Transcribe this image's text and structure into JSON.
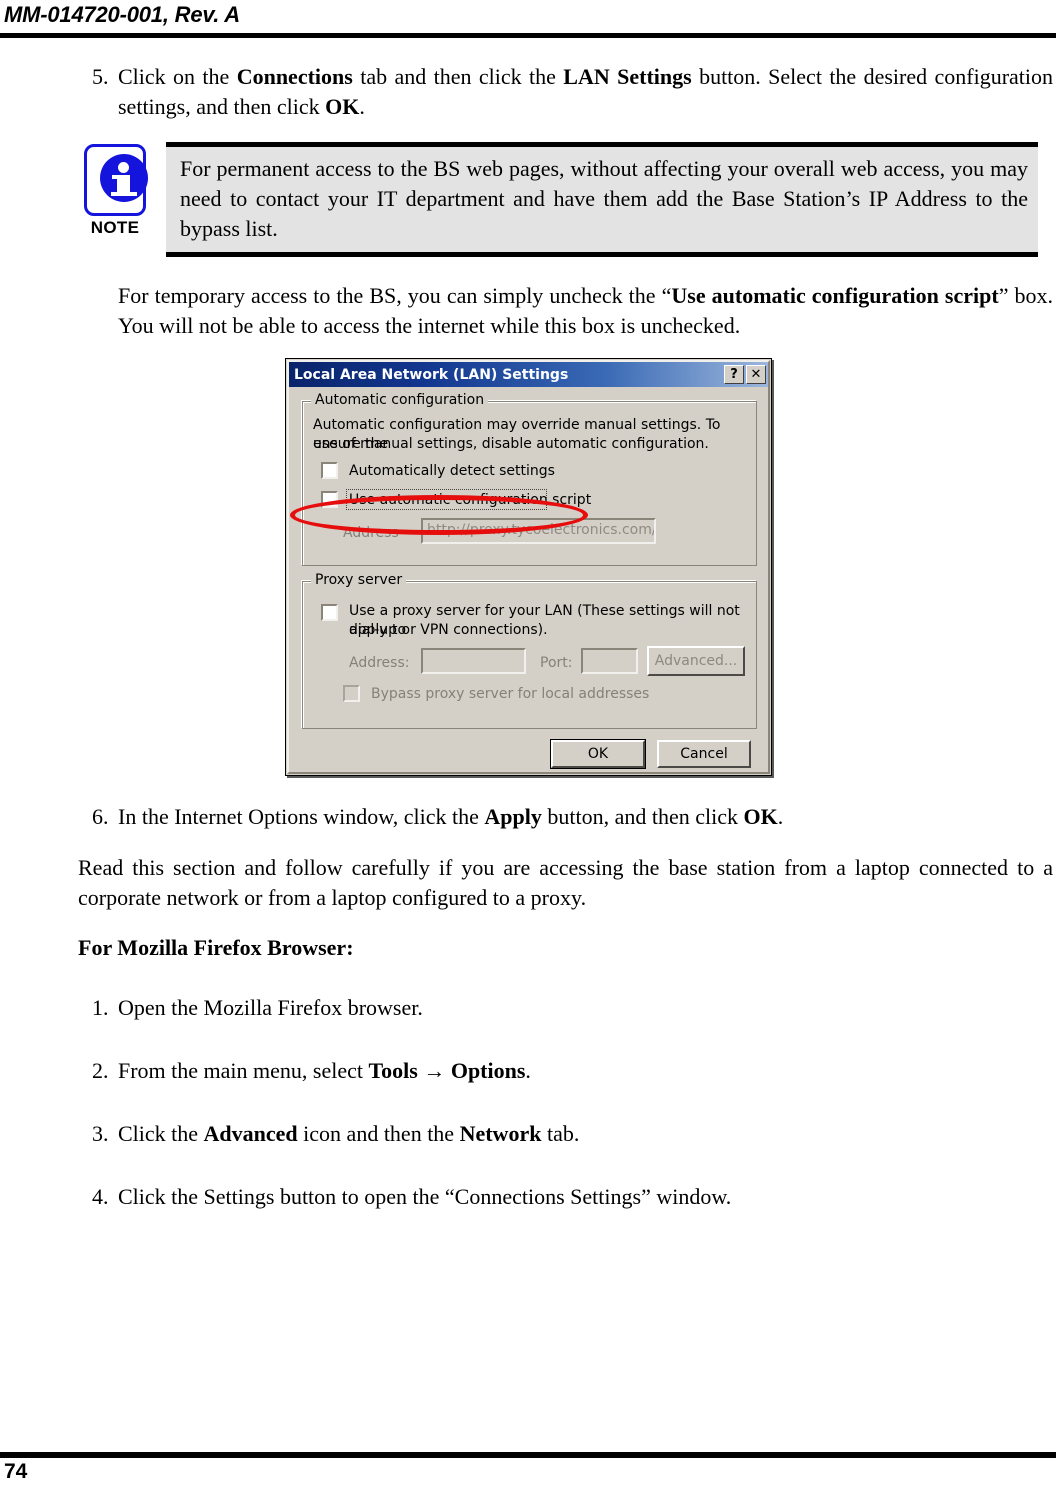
{
  "header": {
    "doc_id": "MM-014720-001, Rev. A"
  },
  "footer": {
    "page_number": "74"
  },
  "steps": {
    "step5": {
      "num": "5.",
      "t1": "Click on the ",
      "b1": "Connections",
      "t2": " tab and then click the ",
      "b2": "LAN Settings",
      "t3": " button.  Select the desired configuration settings, and then click ",
      "b3": "OK",
      "t4": "."
    },
    "step6": {
      "num": "6.",
      "t1": "In the Internet Options window, click the ",
      "b1": "Apply",
      "t2": " button, and then click ",
      "b2": "OK",
      "t3": "."
    }
  },
  "note": {
    "icon_label": "NOTE",
    "text": "For permanent access to the BS web pages, without affecting your overall web access, you may need to contact your IT department and have them add the Base Station’s IP Address to the bypass list."
  },
  "paragraphs": {
    "temp_access": {
      "t1": "For temporary access to the BS, you can simply uncheck the “",
      "b1": "Use automatic configuration script",
      "t2": "” box.  You will not be able to access the internet while this box is unchecked."
    },
    "read_section": "Read this section and follow carefully if you are accessing the base station from a laptop connected to a corporate network or from a laptop configured to a proxy."
  },
  "firefox_section": {
    "heading": "For Mozilla Firefox Browser:",
    "items": [
      {
        "num": "1.",
        "t1": "Open the Mozilla Firefox browser.",
        "b1": "",
        "t2": "",
        "b2": "",
        "t3": ""
      },
      {
        "num": "2.",
        "t1": "From the main menu, select ",
        "b1": "Tools → Options",
        "t2": ".",
        "b2": "",
        "t3": ""
      },
      {
        "num": "3.",
        "t1": "Click the ",
        "b1": "Advanced",
        "t2": " icon and then the ",
        "b2": "Network",
        "t3": " tab."
      },
      {
        "num": "4.",
        "t1": "Click the Settings button to open the “Connections Settings” window.",
        "b1": "",
        "t2": "",
        "b2": "",
        "t3": ""
      }
    ]
  },
  "lan_dialog": {
    "title": "Local Area Network (LAN) Settings",
    "help_button": "?",
    "close_button": "✕",
    "auto_config": {
      "group_label": "Automatic configuration",
      "description_line1": "Automatic configuration may override manual settings.  To ensure the",
      "description_line2": "use of manual settings, disable automatic configuration.",
      "auto_detect_label": "Automatically detect settings",
      "auto_detect_checked": false,
      "use_script_label": "Use automatic configuration script",
      "use_script_checked": false,
      "address_label": "Address",
      "address_value": "http://proxy.tycoelectronics.com/au"
    },
    "proxy_server": {
      "group_label": "Proxy server",
      "use_proxy_line1": "Use a proxy server for your LAN (These settings will not apply to",
      "use_proxy_line2": "dial-up or VPN connections).",
      "use_proxy_checked": false,
      "address_label": "Address:",
      "address_value": "",
      "port_label": "Port:",
      "port_value": "",
      "advanced_button": "Advanced...",
      "bypass_label": "Bypass proxy server for local addresses",
      "bypass_checked": false
    },
    "ok_button": "OK",
    "cancel_button": "Cancel"
  },
  "annotation": {
    "highlight_color": "#e60d0d",
    "target": "Automatically detect settings"
  }
}
